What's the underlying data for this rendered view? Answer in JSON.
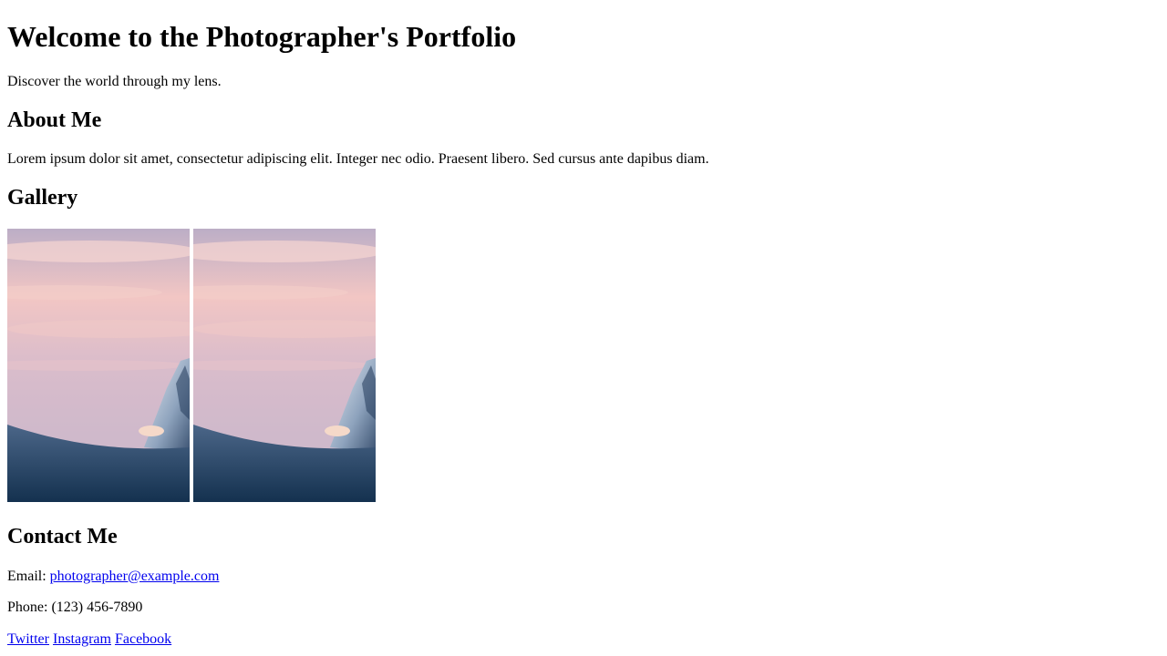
{
  "header": {
    "title": "Welcome to the Photographer's Portfolio",
    "tagline": "Discover the world through my lens."
  },
  "about": {
    "heading": "About Me",
    "text": "Lorem ipsum dolor sit amet, consectetur adipiscing elit. Integer nec odio. Praesent libero. Sed cursus ante dapibus diam."
  },
  "gallery": {
    "heading": "Gallery",
    "photos": [
      {
        "alt": "mountain-sunset-photo"
      },
      {
        "alt": "mountain-sunset-photo"
      }
    ]
  },
  "contact": {
    "heading": "Contact Me",
    "email_label": "Email: ",
    "email": "photographer@example.com",
    "phone": "Phone: (123) 456-7890",
    "social": [
      "Twitter",
      "Instagram",
      "Facebook"
    ]
  },
  "colors": {
    "link": "#0000ee",
    "sky_top": "#c9b4c8",
    "sky_pink": "#f3c9c6",
    "snow_dark": "#1e3a5c"
  }
}
